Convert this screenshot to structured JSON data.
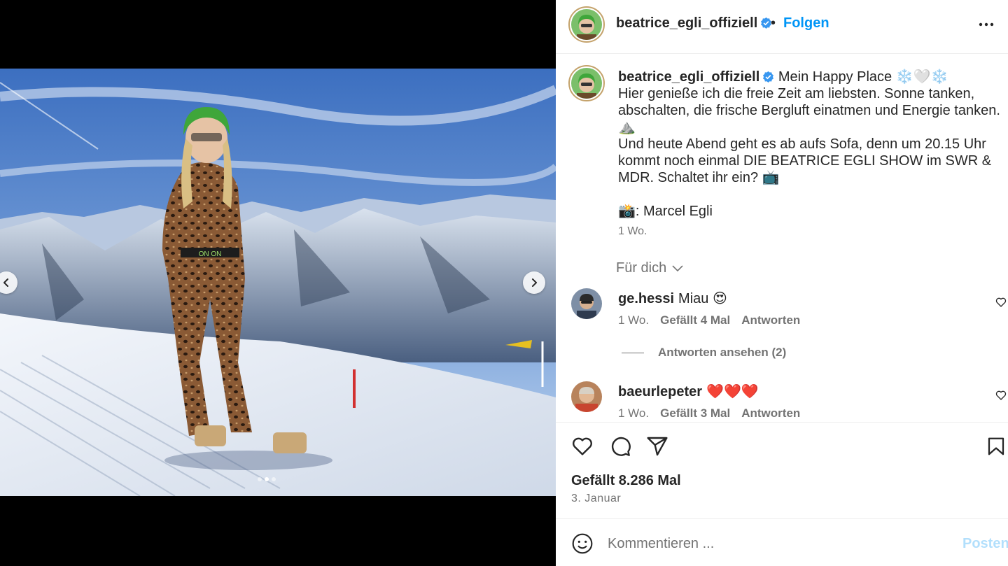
{
  "post": {
    "author": "beatrice_egli_offiziell",
    "separator": "•",
    "follow_label": "Folgen",
    "caption_lines": [
      "Mein Happy Place ❄️🤍❄️",
      "Hier genieße ich die freie Zeit am liebsten. Sonne tanken,",
      "abschalten, die frische Bergluft einatmen und Energie tanken.",
      "⛰️",
      "Und heute Abend geht es ab aufs Sofa, denn um 20.15 Uhr",
      "kommt noch einmal DIE BEATRICE EGLI SHOW im SWR &",
      "MDR. Schaltet ihr ein? 📺",
      "",
      "📸: Marcel Egli"
    ],
    "caption_time": "1 Wo.",
    "for_you_label": "Für dich",
    "likes": "Gefällt 8.286 Mal",
    "date": "3. Januar",
    "carousel": {
      "count": 3,
      "active": 1
    }
  },
  "comments": [
    {
      "user": "ge.hessi",
      "text": "Miau 😍",
      "time": "1 Wo.",
      "likes": "Gefällt 4 Mal",
      "reply_label": "Antworten",
      "view_replies": "Antworten ansehen (2)"
    },
    {
      "user": "baeurlepeter",
      "text": "❤️❤️❤️",
      "time": "1 Wo.",
      "likes": "Gefällt 3 Mal",
      "reply_label": "Antworten"
    }
  ],
  "composer": {
    "placeholder": "Kommentieren ...",
    "post_label": "Posten"
  },
  "icons": {
    "verified": "verified-badge-icon",
    "more": "more-options-icon",
    "like": "heart-icon",
    "comment": "comment-icon",
    "share": "share-icon",
    "save": "bookmark-icon",
    "emoji": "emoji-icon",
    "prev": "chevron-left-icon",
    "next": "chevron-right-icon"
  },
  "colors": {
    "link_blue": "#0095f6",
    "verified_blue": "#3897f0",
    "muted_text": "#737373",
    "post_disabled": "#b2dffc"
  }
}
